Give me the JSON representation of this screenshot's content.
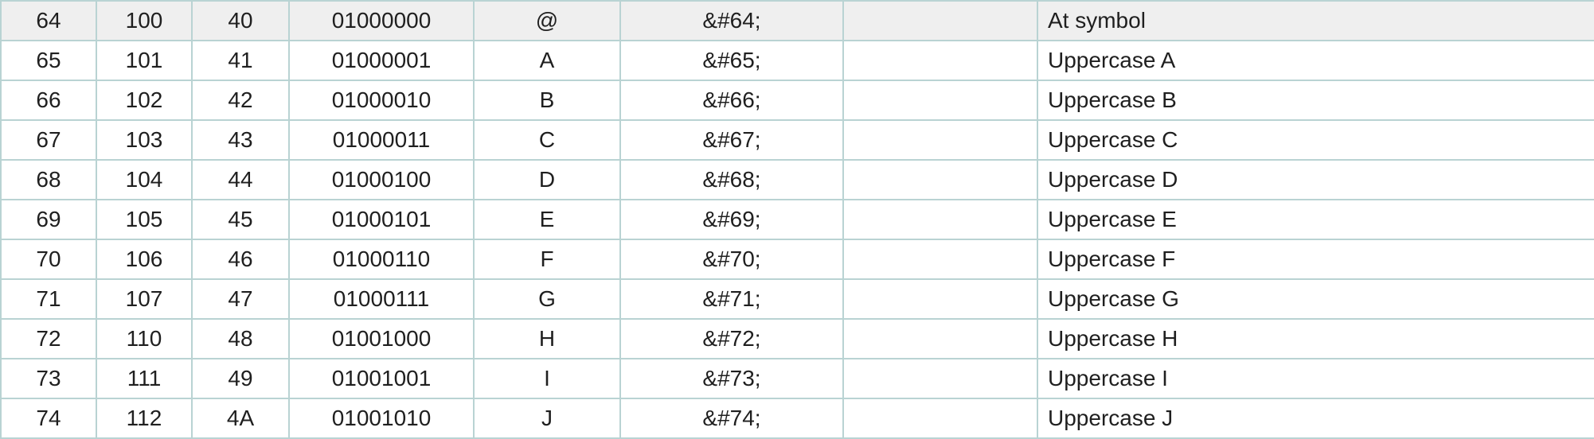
{
  "table": {
    "rows": [
      {
        "dec": "64",
        "oct": "100",
        "hex": "40",
        "bin": "01000000",
        "symbol": "@",
        "html_number": "&#64;",
        "html_name": "",
        "description": "At symbol"
      },
      {
        "dec": "65",
        "oct": "101",
        "hex": "41",
        "bin": "01000001",
        "symbol": "A",
        "html_number": "&#65;",
        "html_name": "",
        "description": "Uppercase A"
      },
      {
        "dec": "66",
        "oct": "102",
        "hex": "42",
        "bin": "01000010",
        "symbol": "B",
        "html_number": "&#66;",
        "html_name": "",
        "description": "Uppercase B"
      },
      {
        "dec": "67",
        "oct": "103",
        "hex": "43",
        "bin": "01000011",
        "symbol": "C",
        "html_number": "&#67;",
        "html_name": "",
        "description": "Uppercase C"
      },
      {
        "dec": "68",
        "oct": "104",
        "hex": "44",
        "bin": "01000100",
        "symbol": "D",
        "html_number": "&#68;",
        "html_name": "",
        "description": "Uppercase D"
      },
      {
        "dec": "69",
        "oct": "105",
        "hex": "45",
        "bin": "01000101",
        "symbol": "E",
        "html_number": "&#69;",
        "html_name": "",
        "description": "Uppercase E"
      },
      {
        "dec": "70",
        "oct": "106",
        "hex": "46",
        "bin": "01000110",
        "symbol": "F",
        "html_number": "&#70;",
        "html_name": "",
        "description": "Uppercase F"
      },
      {
        "dec": "71",
        "oct": "107",
        "hex": "47",
        "bin": "01000111",
        "symbol": "G",
        "html_number": "&#71;",
        "html_name": "",
        "description": "Uppercase G"
      },
      {
        "dec": "72",
        "oct": "110",
        "hex": "48",
        "bin": "01001000",
        "symbol": "H",
        "html_number": "&#72;",
        "html_name": "",
        "description": "Uppercase H"
      },
      {
        "dec": "73",
        "oct": "111",
        "hex": "49",
        "bin": "01001001",
        "symbol": "I",
        "html_number": "&#73;",
        "html_name": "",
        "description": "Uppercase I"
      },
      {
        "dec": "74",
        "oct": "112",
        "hex": "4A",
        "bin": "01001010",
        "symbol": "J",
        "html_number": "&#74;",
        "html_name": "",
        "description": "Uppercase J"
      }
    ]
  }
}
